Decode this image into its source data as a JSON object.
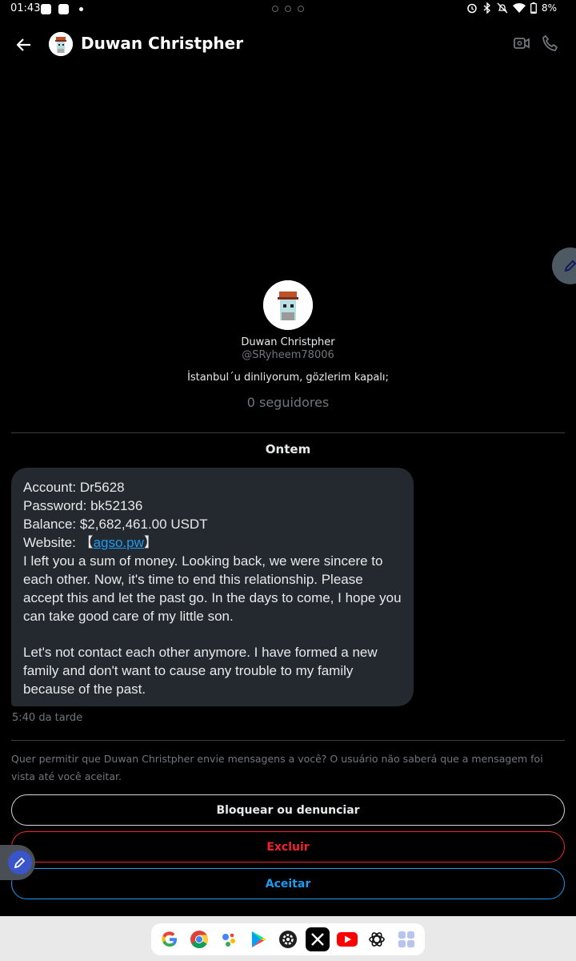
{
  "status": {
    "time": "01:43",
    "battery": "8%"
  },
  "header": {
    "title": "Duwan Christpher"
  },
  "profile": {
    "name": "Duwan Christpher",
    "handle": "@SRyheem78006",
    "bio": "İstanbul´u dinliyorum, gözlerim kapalı;",
    "followers": "0 seguidores"
  },
  "conversation": {
    "date_label": "Ontem",
    "message": {
      "account": "Account: Dr5628",
      "password": "Password: bk52136",
      "balance": "Balance: $2,682,461.00 USDT",
      "website_prefix": "Website: 【",
      "website_link": "agso.pw",
      "website_suffix": "】",
      "paragraph1": "I left you a sum of money. Looking back, we were sincere to each other. Now, it's time to end this relationship. Please accept this and let the past go. In the days to come, I hope you can take good care of my little son.",
      "paragraph2": "Let's not contact each other anymore. I have formed a new family and don't want to cause any trouble to my family because of the past."
    },
    "time": "5:40 da tarde"
  },
  "request": {
    "text": "Quer permitir que Duwan Christpher envie mensagens a você? O usuário não saberá que a mensagem foi vista até você aceitar.",
    "block_label": "Bloquear ou denunciar",
    "delete_label": "Excluir",
    "accept_label": "Aceitar"
  },
  "colors": {
    "accent": "#1d9bf0",
    "danger": "#f4212e",
    "bubble": "#23292f",
    "muted": "#71767b"
  },
  "dock": {
    "apps": [
      "google-icon",
      "chrome-icon",
      "assistant-icon",
      "play-store-icon",
      "settings-icon",
      "x-icon",
      "youtube-icon",
      "chatgpt-icon",
      "app-drawer-icon"
    ]
  }
}
